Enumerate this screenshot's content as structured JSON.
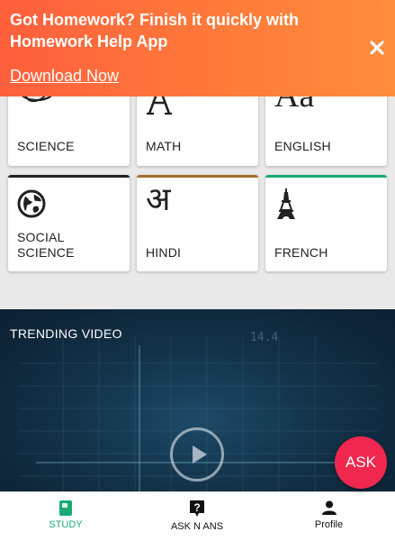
{
  "banner": {
    "title": "Got Homework? Finish it quickly with Homework Help App",
    "link": "Download Now",
    "close_icon": "close-icon",
    "colors": {
      "start": "#ff5f3c",
      "end": "#ff8c3d"
    }
  },
  "subjects": [
    {
      "label": "SCIENCE",
      "icon": "atom-icon"
    },
    {
      "label": "MATH",
      "icon": "math-a-icon"
    },
    {
      "label": "ENGLISH",
      "icon": "aa-icon",
      "glyph": "Aa"
    },
    {
      "label": "SOCIAL SCIENCE",
      "icon": "globe-icon",
      "accent": "#222222"
    },
    {
      "label": "HINDI",
      "icon": "devanagari-a-icon",
      "glyph": "अ",
      "accent": "#a0702a"
    },
    {
      "label": "FRENCH",
      "icon": "eiffel-tower-icon",
      "accent": "#1aaa72"
    }
  ],
  "video": {
    "title": "TRENDING VIDEO",
    "overlay_text": "14.4",
    "play_icon": "play-icon"
  },
  "fab": {
    "label": "ASK",
    "color": "#f0274f"
  },
  "bottom_nav": [
    {
      "label": "STUDY",
      "icon": "book-icon",
      "active": true,
      "color": "#1aaa72"
    },
    {
      "label": "ASK N ANS",
      "icon": "question-icon",
      "active": false
    },
    {
      "label": "Profile",
      "icon": "person-icon",
      "active": false
    }
  ]
}
